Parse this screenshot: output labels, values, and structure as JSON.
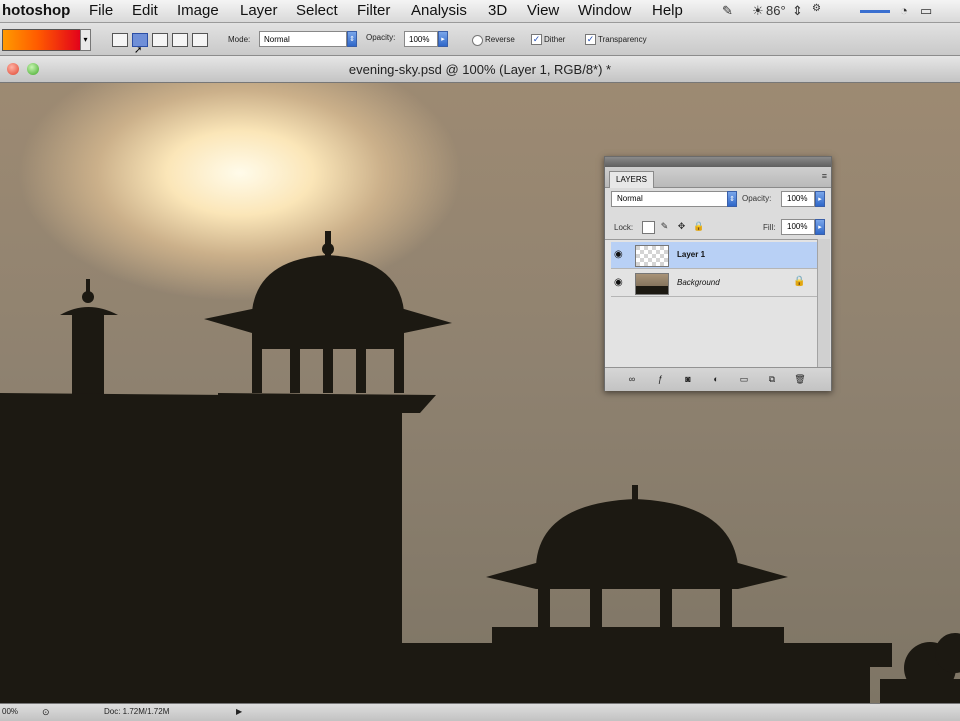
{
  "menubar": {
    "app": "hotoshop",
    "items": [
      "File",
      "Edit",
      "Image",
      "Layer",
      "Select",
      "Filter",
      "Analysis",
      "3D",
      "View",
      "Window",
      "Help"
    ],
    "temperature": "86°"
  },
  "options": {
    "mode_label": "Mode:",
    "mode_value": "Normal",
    "opacity_label": "Opacity:",
    "opacity_value": "100%",
    "reverse_label": "Reverse",
    "dither_label": "Dither",
    "transparency_label": "Transparency",
    "dither_checked": true,
    "transparency_checked": true
  },
  "document": {
    "title": "evening-sky.psd @ 100% (Layer 1, RGB/8*) *"
  },
  "layers_panel": {
    "tab_label": "LAYERS",
    "blend_mode": "Normal",
    "opacity_label": "Opacity:",
    "opacity_value": "100%",
    "lock_label": "Lock:",
    "fill_label": "Fill:",
    "fill_value": "100%",
    "layers": [
      {
        "name": "Layer 1",
        "selected": true
      },
      {
        "name": "Background",
        "selected": false
      }
    ],
    "footer_link": "∞"
  },
  "statusbar": {
    "zoom": "00%",
    "doc_info": "Doc: 1.72M/1.72M"
  },
  "colors": {
    "selection": "#b8d0f5",
    "accent": "#3a6fd0"
  }
}
